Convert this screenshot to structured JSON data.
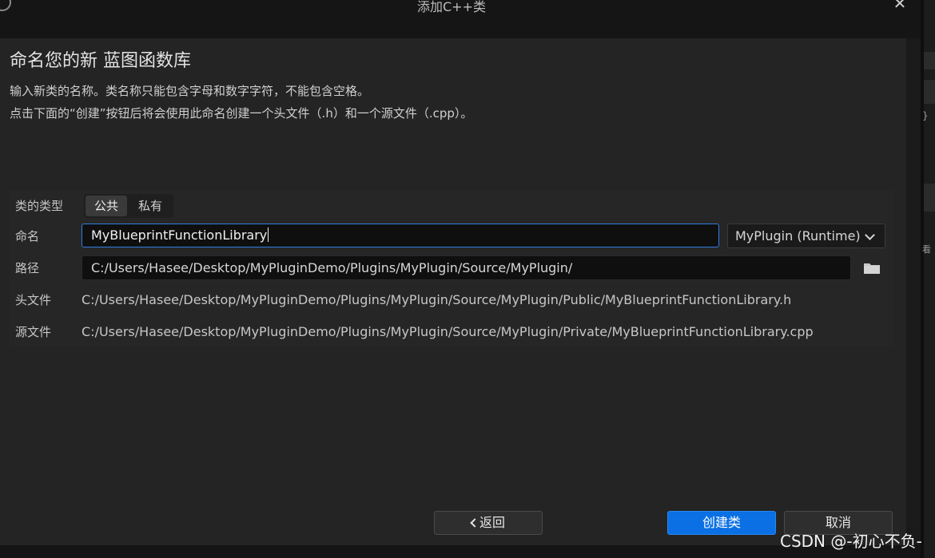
{
  "window": {
    "title": "添加C++类",
    "close_glyph": "✕"
  },
  "header": {
    "title": "命名您的新 蓝图函数库",
    "desc_line1": "输入新类的名称。类名称只能包含字母和数字字符，不能包含空格。",
    "desc_line2": "点击下面的“创建”按钮后将会使用此命名创建一个头文件（.h）和一个源文件（.cpp）。"
  },
  "form": {
    "class_type_label": "类的类型",
    "class_type_options": [
      "公共",
      "私有"
    ],
    "class_type_selected": "公共",
    "name_label": "命名",
    "name_value": "MyBlueprintFunctionLibrary",
    "module_value": "MyPlugin (Runtime)",
    "path_label": "路径",
    "path_value": "C:/Users/Hasee/Desktop/MyPluginDemo/Plugins/MyPlugin/Source/MyPlugin/",
    "header_label": "头文件",
    "header_value": "C:/Users/Hasee/Desktop/MyPluginDemo/Plugins/MyPlugin/Source/MyPlugin/Public/MyBlueprintFunctionLibrary.h",
    "source_label": "源文件",
    "source_value": "C:/Users/Hasee/Desktop/MyPluginDemo/Plugins/MyPlugin/Source/MyPlugin/Private/MyBlueprintFunctionLibrary.cpp"
  },
  "footer": {
    "back_label": "返回",
    "create_label": "创建类",
    "cancel_label": "取消"
  },
  "side": {
    "glyph1": "}",
    "glyph2": "看"
  },
  "watermark": "CSDN @-初心不负-",
  "colors": {
    "accent": "#0a70e4",
    "focus_border": "#2f7de0",
    "panel_bg": "#242424"
  }
}
